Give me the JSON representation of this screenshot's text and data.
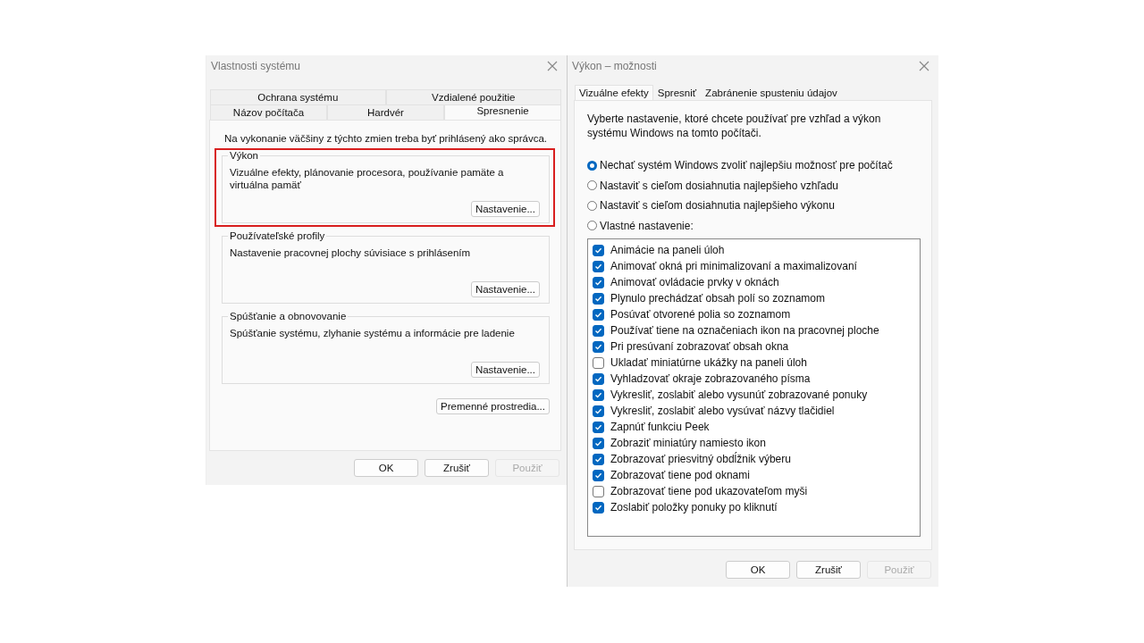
{
  "system_properties": {
    "title": "Vlastnosti systému",
    "tab_rows": [
      [
        {
          "label": "Ochrana systému",
          "selected": false
        },
        {
          "label": "Vzdialené použitie",
          "selected": false
        }
      ],
      [
        {
          "label": "Názov počítača",
          "selected": false
        },
        {
          "label": "Hardvér",
          "selected": false
        },
        {
          "label": "Spresnenie",
          "selected": true
        }
      ]
    ],
    "notice": "Na vykonanie väčšiny z týchto zmien treba byť prihlásený ako správca.",
    "groups": [
      {
        "title": "Výkon",
        "description": "Vizuálne efekty, plánovanie procesora, používanie pamäte a virtuálna pamäť",
        "button": "Nastavenie...",
        "highlighted": true
      },
      {
        "title": "Používateľské profily",
        "description": "Nastavenie pracovnej plochy súvisiace s prihlásením",
        "button": "Nastavenie...",
        "highlighted": false
      },
      {
        "title": "Spúšťanie a obnovovanie",
        "description": "Spúšťanie systému, zlyhanie systému a informácie pre ladenie",
        "button": "Nastavenie...",
        "highlighted": false
      }
    ],
    "env_button": "Premenné prostredia...",
    "buttons": [
      {
        "label": "OK",
        "disabled": false
      },
      {
        "label": "Zrušiť",
        "disabled": false
      },
      {
        "label": "Použiť",
        "disabled": true
      }
    ]
  },
  "performance_options": {
    "title": "Výkon – možnosti",
    "tabs": [
      {
        "label": "Vizuálne efekty",
        "selected": true
      },
      {
        "label": "Spresniť",
        "selected": false
      },
      {
        "label": "Zabránenie spusteniu údajov",
        "selected": false
      }
    ],
    "intro": "Vyberte nastavenie, ktoré chcete používať pre vzhľad a výkon systému Windows na tomto počítači.",
    "options": [
      {
        "label": "Nechať systém Windows zvoliť najlepšiu možnosť pre počítač",
        "selected": true
      },
      {
        "label": "Nastaviť s cieľom dosiahnutia najlepšieho vzhľadu",
        "selected": false
      },
      {
        "label": "Nastaviť s cieľom dosiahnutia najlepšieho výkonu",
        "selected": false
      },
      {
        "label": "Vlastné nastavenie:",
        "selected": false
      }
    ],
    "effects": [
      {
        "label": "Animácie na paneli úloh",
        "checked": true
      },
      {
        "label": "Animovať okná pri minimalizovaní a maximalizovaní",
        "checked": true
      },
      {
        "label": "Animovať ovládacie prvky v oknách",
        "checked": true
      },
      {
        "label": "Plynulo prechádzať obsah polí so zoznamom",
        "checked": true
      },
      {
        "label": "Posúvať otvorené polia so zoznamom",
        "checked": true
      },
      {
        "label": "Používať tiene na označeniach ikon na pracovnej ploche",
        "checked": true
      },
      {
        "label": "Pri presúvaní zobrazovať obsah okna",
        "checked": true
      },
      {
        "label": "Ukladať miniatúrne ukážky na paneli úloh",
        "checked": false
      },
      {
        "label": "Vyhladzovať okraje zobrazovaného písma",
        "checked": true
      },
      {
        "label": "Vykresliť, zoslabiť alebo vysunúť zobrazované ponuky",
        "checked": true
      },
      {
        "label": "Vykresliť, zoslabiť alebo vysúvať názvy tlačidiel",
        "checked": true
      },
      {
        "label": "Zapnúť funkciu Peek",
        "checked": true
      },
      {
        "label": "Zobraziť miniatúry namiesto ikon",
        "checked": true
      },
      {
        "label": "Zobrazovať priesvitný obdĺžnik výberu",
        "checked": true
      },
      {
        "label": "Zobrazovať tiene pod oknami",
        "checked": true
      },
      {
        "label": "Zobrazovať tiene pod ukazovateľom myši",
        "checked": false
      },
      {
        "label": "Zoslabiť položky ponuky po kliknutí",
        "checked": true
      }
    ],
    "buttons": [
      {
        "label": "OK",
        "disabled": false
      },
      {
        "label": "Zrušiť",
        "disabled": false
      },
      {
        "label": "Použiť",
        "disabled": true
      }
    ]
  }
}
